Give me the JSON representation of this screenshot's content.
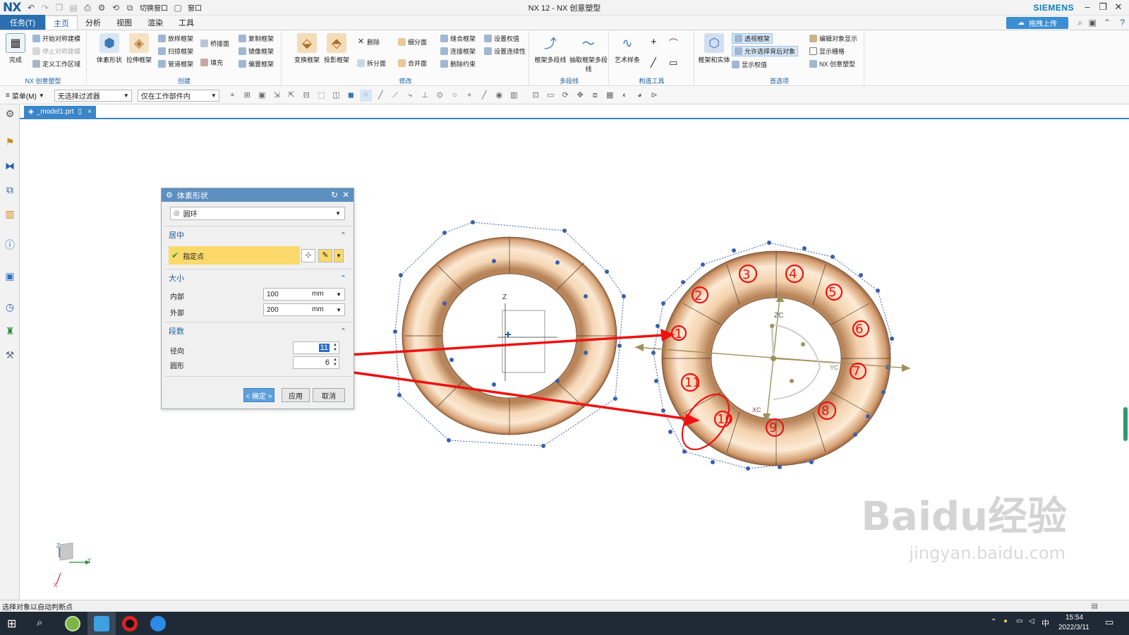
{
  "titlebar": {
    "logo": "NX",
    "switch_window": "切换窗口",
    "window_menu": "窗口",
    "title": "NX 12 - NX 创意塑型",
    "brand": "SIEMENS"
  },
  "tabs": {
    "task": "任务(T)",
    "items": [
      "主页",
      "分析",
      "视图",
      "渲染",
      "工具"
    ],
    "active": "主页",
    "cloud_button": "拖拽上传"
  },
  "ribbon": {
    "g1": {
      "label": "NX 创意塑型",
      "finish": "完成",
      "start_sym": "开始对称建模",
      "stop_sym": "停止对称建模",
      "work_region": "定义工作区域"
    },
    "g2": {
      "label": "创建",
      "body_shape": "体素形状",
      "extrude_frame": "拉伸框架",
      "loft_frame": "放样框架",
      "sweep_frame": "扫掠框架",
      "pipe_frame": "管道框架",
      "bridge_face": "桥接面",
      "fill": "填充",
      "copy_frame": "复制框架",
      "mirror_frame": "镜像框架",
      "offset_frame": "偏置框架"
    },
    "g3": {
      "label": "修改",
      "transform_frame": "变换框架",
      "project_frame": "投影框架",
      "delete": "删除",
      "split_face": "拆分面",
      "subdivide_face": "细分面",
      "merge_face": "合并面",
      "stitch_frame": "缝合框架",
      "connect_frame": "连接框架",
      "remove_constraint": "删除约束",
      "set_weight": "设置权值",
      "set_continuity": "设置连续性"
    },
    "g4": {
      "label": "多段线",
      "frame_polyline": "框架多段线",
      "extract_polyline": "抽取框架多段线"
    },
    "g5": {
      "label": "构造工具",
      "art_spline": "艺术样条"
    },
    "g6": {
      "label": "首选项",
      "frame_and_body": "框架和实体",
      "see_through_frame": "透视框架",
      "allow_select_behind": "允许选择背后对象",
      "show_weights": "显示权值",
      "edit_display": "编辑对象显示",
      "show_grid": "显示栅格",
      "nx_realize": "NX 创意塑型"
    }
  },
  "toolbar2": {
    "menu": "菜单(M)",
    "filter": "无选择过滤器",
    "scope": "仅在工作部件内"
  },
  "document_tab": "_model1.prt",
  "dialog": {
    "title": "体素形状",
    "shape_type": "圆环",
    "section_center": "居中",
    "specify_point": "指定点",
    "section_size": "大小",
    "inner_label": "内部",
    "inner_value": "100",
    "inner_unit": "mm",
    "outer_label": "外部",
    "outer_value": "200",
    "outer_unit": "mm",
    "section_segments": "段数",
    "radial_label": "径向",
    "radial_value": "11",
    "circular_label": "圆形",
    "circular_value": "6",
    "ok": "< 确定 >",
    "apply": "应用",
    "cancel": "取消"
  },
  "viewport": {
    "axis_z": "Z",
    "axis_zc": "ZC",
    "axis_yc": "YC",
    "axis_xc": "XC",
    "triad_z": "Z",
    "triad_y": "Y",
    "triad_x": "X",
    "annotation_numbers": [
      "1",
      "2",
      "3",
      "4",
      "5",
      "6",
      "7",
      "8",
      "9",
      "10",
      "11"
    ],
    "segment_circle_mark": "6"
  },
  "statusbar": {
    "text": "选择对象以自动判断点"
  },
  "taskbar": {
    "time": "15:54",
    "date": "2022/3/11",
    "ime": "中"
  },
  "watermark": {
    "main": "Baidu经验",
    "sub": "jingyan.baidu.com"
  }
}
